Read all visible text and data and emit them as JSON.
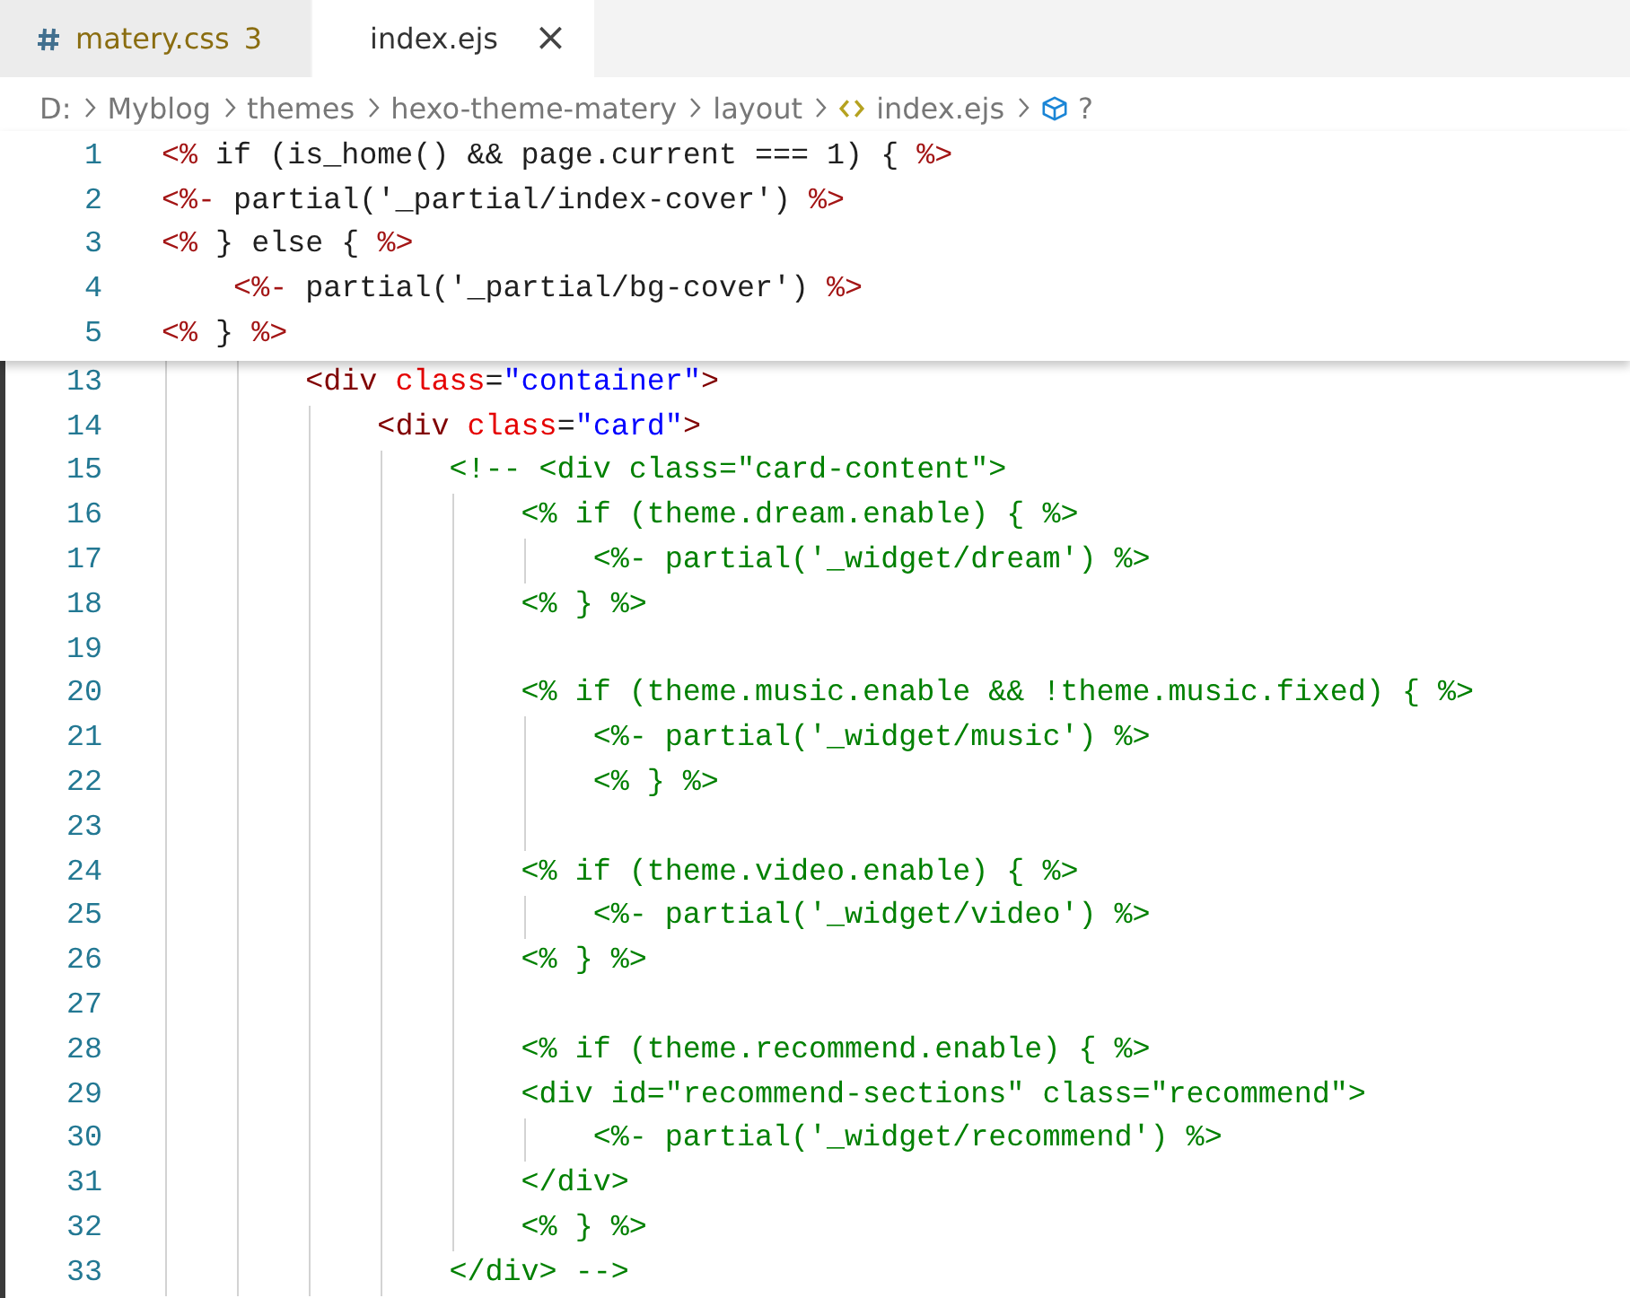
{
  "tabs": [
    {
      "kind": "css",
      "label": "matery.css",
      "badge": "3",
      "warning": true,
      "selected": false
    },
    {
      "kind": "ejs",
      "label": "index.ejs",
      "warning": false,
      "selected": true,
      "close": "×"
    }
  ],
  "breadcrumb": [
    {
      "kind": "text",
      "label": "D:"
    },
    {
      "kind": "text",
      "label": "Myblog"
    },
    {
      "kind": "text",
      "label": "themes"
    },
    {
      "kind": "text",
      "label": "hexo-theme-matery"
    },
    {
      "kind": "text",
      "label": "layout"
    },
    {
      "kind": "file",
      "label": "index.ejs"
    },
    {
      "kind": "symbol",
      "label": "?"
    }
  ],
  "sticky_lines": [
    {
      "number": "1",
      "tokens": [
        {
          "kind": "delim",
          "t": "<%"
        },
        {
          "kind": "plain",
          "t": " if (is_home() && page.current === 1) { "
        },
        {
          "kind": "delim",
          "t": "%>"
        }
      ]
    },
    {
      "number": "2",
      "tokens": [
        {
          "kind": "delim",
          "t": "<%-"
        },
        {
          "kind": "plain",
          "t": " partial('_partial/index-cover') "
        },
        {
          "kind": "delim",
          "t": "%>"
        }
      ]
    },
    {
      "number": "3",
      "tokens": [
        {
          "kind": "delim",
          "t": "<%"
        },
        {
          "kind": "plain",
          "t": " } else { "
        },
        {
          "kind": "delim",
          "t": "%>"
        }
      ]
    },
    {
      "number": "4",
      "tokens": [
        {
          "kind": "delim",
          "t": "    <%-"
        },
        {
          "kind": "plain",
          "t": " partial('_partial/bg-cover') "
        },
        {
          "kind": "delim",
          "t": "%>"
        }
      ]
    },
    {
      "number": "5",
      "tokens": [
        {
          "kind": "delim",
          "t": "<%"
        },
        {
          "kind": "plain",
          "t": " } "
        },
        {
          "kind": "delim",
          "t": "%>"
        }
      ]
    }
  ],
  "lines": [
    {
      "number": "13",
      "tokens": [
        {
          "kind": "bracket",
          "t": "        <"
        },
        {
          "kind": "tag",
          "t": "div"
        },
        {
          "kind": "attr",
          "t": " class"
        },
        {
          "kind": "plain",
          "t": "="
        },
        {
          "kind": "string",
          "t": "\"container\""
        },
        {
          "kind": "bracket",
          "t": ">"
        }
      ]
    },
    {
      "number": "14",
      "tokens": [
        {
          "kind": "bracket",
          "t": "            <"
        },
        {
          "kind": "tag",
          "t": "div"
        },
        {
          "kind": "attr",
          "t": " class"
        },
        {
          "kind": "plain",
          "t": "="
        },
        {
          "kind": "string",
          "t": "\"card\""
        },
        {
          "kind": "bracket",
          "t": ">"
        }
      ]
    },
    {
      "number": "15",
      "tokens": [
        {
          "kind": "comment",
          "t": "                <!-- <div class=\"card-content\">"
        }
      ]
    },
    {
      "number": "16",
      "tokens": [
        {
          "kind": "comment",
          "t": "                    <% if (theme.dream.enable) { %>"
        }
      ]
    },
    {
      "number": "17",
      "tokens": [
        {
          "kind": "comment",
          "t": "                        <%- partial('_widget/dream') %>"
        }
      ]
    },
    {
      "number": "18",
      "tokens": [
        {
          "kind": "comment",
          "t": "                    <% } %>"
        }
      ]
    },
    {
      "number": "19"
    },
    {
      "number": "20",
      "tokens": [
        {
          "kind": "comment",
          "t": "                    <% if (theme.music.enable && !theme.music.fixed) { %>"
        }
      ]
    },
    {
      "number": "21",
      "tokens": [
        {
          "kind": "comment",
          "t": "                        <%- partial('_widget/music') %>"
        }
      ]
    },
    {
      "number": "22",
      "tokens": [
        {
          "kind": "comment",
          "t": "                        <% } %>"
        }
      ]
    },
    {
      "number": "23"
    },
    {
      "number": "24",
      "tokens": [
        {
          "kind": "comment",
          "t": "                    <% if (theme.video.enable) { %>"
        }
      ]
    },
    {
      "number": "25",
      "tokens": [
        {
          "kind": "comment",
          "t": "                        <%- partial('_widget/video') %>"
        }
      ]
    },
    {
      "number": "26",
      "tokens": [
        {
          "kind": "comment",
          "t": "                    <% } %>"
        }
      ]
    },
    {
      "number": "27"
    },
    {
      "number": "28",
      "tokens": [
        {
          "kind": "comment",
          "t": "                    <% if (theme.recommend.enable) { %>"
        }
      ]
    },
    {
      "number": "29",
      "tokens": [
        {
          "kind": "comment",
          "t": "                    <div id=\"recommend-sections\" class=\"recommend\">"
        }
      ]
    },
    {
      "number": "30",
      "tokens": [
        {
          "kind": "comment",
          "t": "                        <%- partial('_widget/recommend') %>"
        }
      ]
    },
    {
      "number": "31",
      "tokens": [
        {
          "kind": "comment",
          "t": "                    </div>"
        }
      ]
    },
    {
      "number": "32",
      "tokens": [
        {
          "kind": "comment",
          "t": "                    <% } %>"
        }
      ]
    },
    {
      "number": "33",
      "tokens": [
        {
          "kind": "comment",
          "t": "                </div> -->"
        }
      ]
    }
  ]
}
